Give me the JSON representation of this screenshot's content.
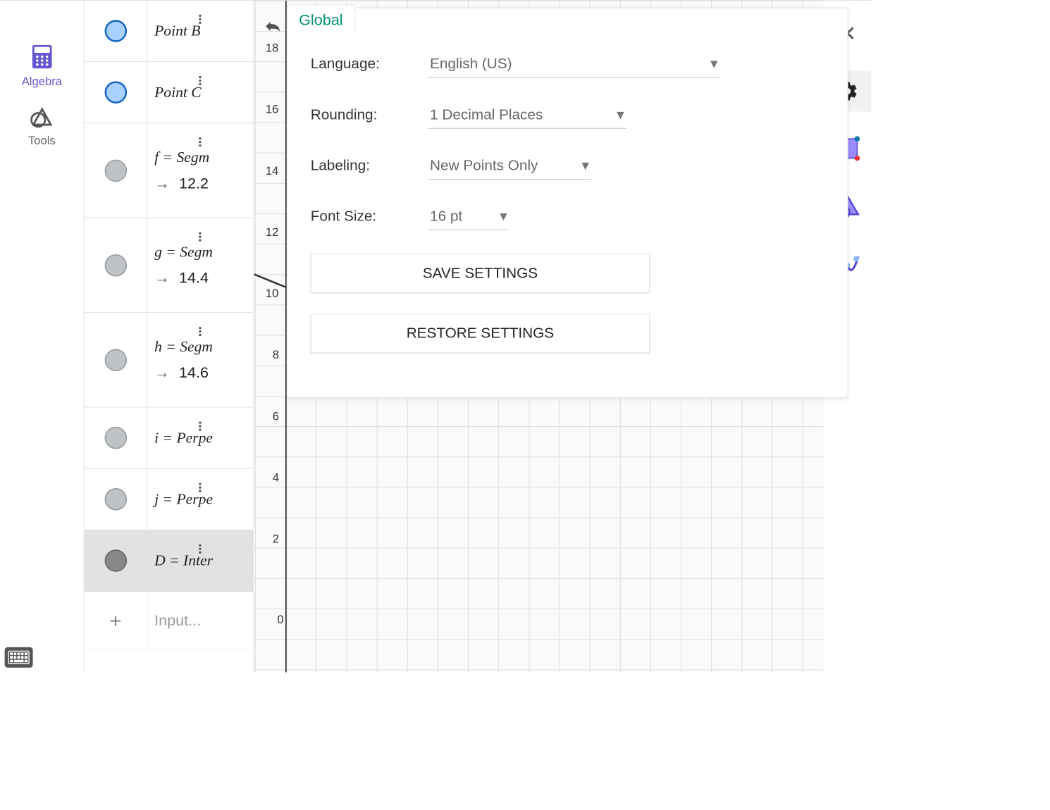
{
  "leftnav": {
    "algebra_label": "Algebra",
    "tools_label": "Tools"
  },
  "algebra_list": [
    {
      "kind": "point",
      "formula": "Point B"
    },
    {
      "kind": "point",
      "formula": "Point C"
    },
    {
      "kind": "segment",
      "formula": "f = Segm",
      "value": "12.2"
    },
    {
      "kind": "segment",
      "formula": "g = Segm",
      "value": "14.4"
    },
    {
      "kind": "segment",
      "formula": "h = Segm",
      "value": "14.6"
    },
    {
      "kind": "line",
      "formula": "i = Perpe"
    },
    {
      "kind": "line",
      "formula": "j = Perpe"
    },
    {
      "kind": "point_gray",
      "formula": "D = Inter",
      "selected": true
    }
  ],
  "input_placeholder": "Input...",
  "axis_ticks": [
    "18",
    "16",
    "14",
    "12",
    "10",
    "8",
    "6",
    "4",
    "2",
    "0"
  ],
  "settings": {
    "tab": "Global",
    "language_label": "Language:",
    "language_value": "English (US)",
    "rounding_label": "Rounding:",
    "rounding_value": "1 Decimal Places",
    "labeling_label": "Labeling:",
    "labeling_value": "New Points Only",
    "fontsize_label": "Font Size:",
    "fontsize_value": "16 pt",
    "save": "SAVE SETTINGS",
    "restore": "RESTORE SETTINGS"
  }
}
